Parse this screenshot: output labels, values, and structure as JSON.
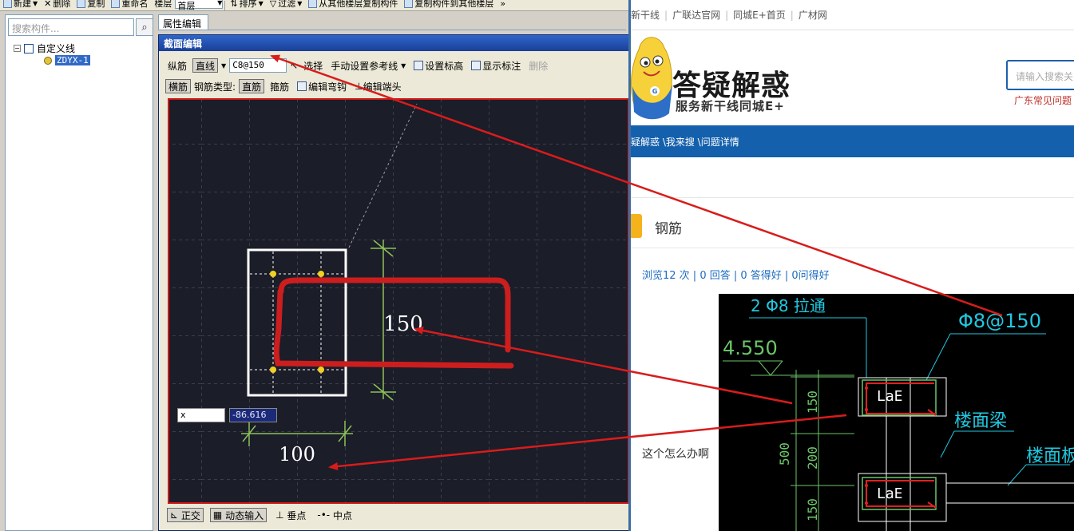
{
  "toolbar": {
    "new_label": "新建",
    "delete_label": "删除",
    "copy_label": "复制",
    "rename_label": "重命名",
    "floor_label": "楼层",
    "floor_value": "首层",
    "sort_label": "排序",
    "filter_label": "过滤",
    "copy_from_label": "从其他楼层复制构件",
    "copy_to_label": "复制构件到其他楼层",
    "overflow": "»"
  },
  "tree": {
    "search_placeholder": "搜索构件...",
    "root_label": "自定义线",
    "child_label": "ZDYX-1"
  },
  "attr_tab": "属性编辑",
  "editor": {
    "title": "截面编辑",
    "row1": {
      "longitudinal": "纵筋",
      "straight": "直线",
      "spec": "C8@150",
      "select": "选择",
      "ref_line": "手动设置参考线",
      "set_elevation": "设置标高",
      "show_dims": "显示标注",
      "delete": "删除"
    },
    "row2": {
      "transverse": "横筋",
      "rebar_type_label": "钢筋类型:",
      "straight_bar": "直筋",
      "stirrup": "箍筋",
      "edit_hook": "编辑弯钩",
      "edit_end": "编辑端头"
    },
    "canvas": {
      "dim_height": "150",
      "dim_width": "100",
      "coord_x": "x",
      "coord_y": "-86.616"
    },
    "status": {
      "ortho": "正交",
      "dynamic_input": "动态输入",
      "perpendicular": "垂点",
      "midpoint": "中点"
    }
  },
  "web": {
    "nav": [
      "新干线",
      "广联达官网",
      "同城E+首页",
      "广材网"
    ],
    "logo_title": "答疑解惑",
    "logo_sub": "服务新干线同城E+",
    "search_placeholder": "请输入搜索关",
    "hot_link": "广东常见问题",
    "breadcrumb": "疑解惑 \\我来搜 \\问题详情",
    "topic": "钢筋",
    "stats": "浏览12 次 | 0 回答 | 0 答得好 | 0问得好",
    "question": "这个怎么办啊"
  },
  "cad": {
    "label_top": "2 Φ8  拉通",
    "label_spec": "Φ8@150",
    "label_elev": "4.550",
    "label_lae_1": "LaE",
    "label_lae_2": "LaE",
    "label_beam": "楼面梁",
    "label_slab": "楼面板",
    "dim_150a": "150",
    "dim_200": "200",
    "dim_150b": "150",
    "dim_500": "500"
  },
  "colors": {
    "annotation_arrow": "#d81c1c",
    "canvas_bg": "#1b1d28",
    "web_blue": "#1460ac",
    "dim_green": "#8cc25a"
  }
}
